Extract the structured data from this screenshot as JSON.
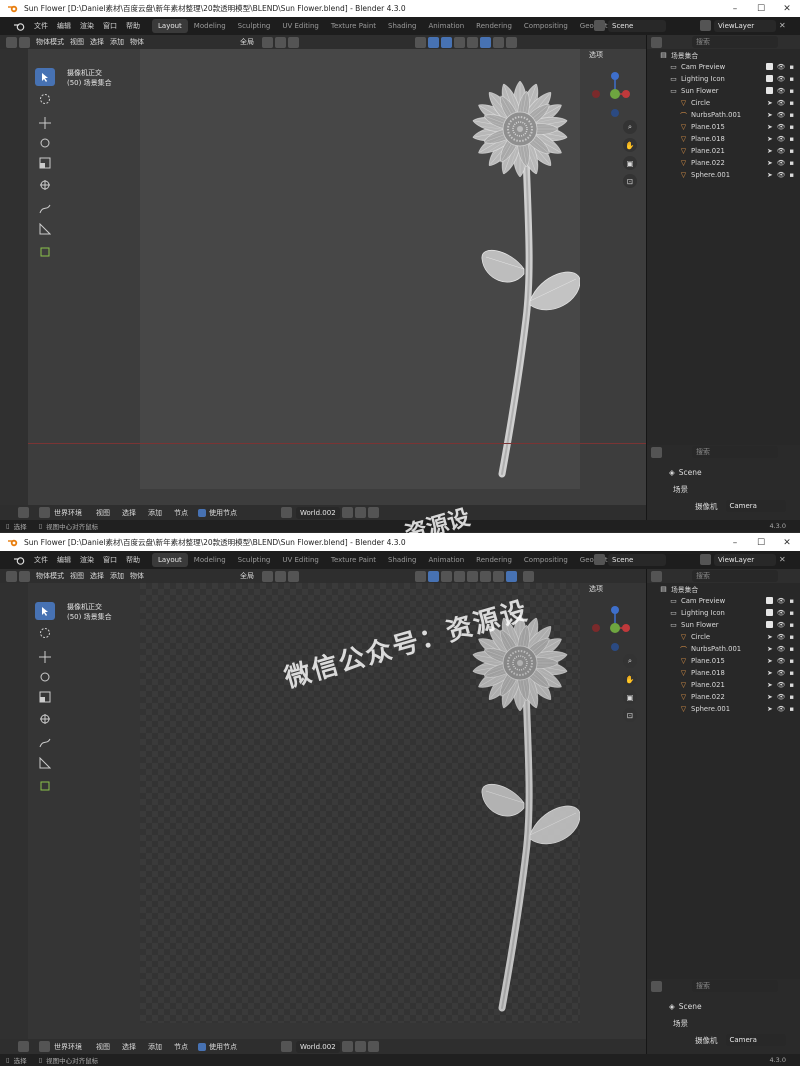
{
  "window": {
    "title": "Sun Flower [D:\\Daniel素材\\百度云盘\\新年素材整理\\20款透明模型\\BLEND\\Sun Flower.blend] - Blender 4.3.0",
    "controls": [
      "–",
      "☐",
      "✕"
    ]
  },
  "menu": [
    "文件",
    "编辑",
    "渲染",
    "窗口",
    "帮助"
  ],
  "workspaces": [
    "Layout",
    "Modeling",
    "Sculpting",
    "UV Editing",
    "Texture Paint",
    "Shading",
    "Animation",
    "Rendering",
    "Compositing",
    "Geometry Nodes"
  ],
  "active_workspace": "Layout",
  "scene": "Scene",
  "view_layer": "ViewLayer",
  "viewport_header": {
    "mode": "物体模式",
    "items": [
      "视图",
      "选择",
      "添加",
      "物体"
    ],
    "transform": "全局",
    "options": "选项"
  },
  "viewport_info": {
    "line1": "摄像机正交",
    "line2": "(50) 场景集合"
  },
  "outliner": {
    "search_placeholder": "搜索",
    "root": "场景集合",
    "rows": [
      {
        "name": "Cam Preview",
        "level": 1,
        "type": "collection"
      },
      {
        "name": "Lighting Icon",
        "level": 1,
        "type": "collection"
      },
      {
        "name": "Sun Flower",
        "level": 1,
        "type": "collection"
      },
      {
        "name": "Circle",
        "level": 2,
        "type": "mesh"
      },
      {
        "name": "NurbsPath.001",
        "level": 2,
        "type": "curve"
      },
      {
        "name": "Plane.015",
        "level": 2,
        "type": "mesh"
      },
      {
        "name": "Plane.018",
        "level": 2,
        "type": "mesh"
      },
      {
        "name": "Plane.021",
        "level": 2,
        "type": "mesh"
      },
      {
        "name": "Plane.022",
        "level": 2,
        "type": "mesh"
      },
      {
        "name": "Sphere.001",
        "level": 2,
        "type": "mesh"
      }
    ]
  },
  "properties": {
    "search_placeholder": "搜索",
    "scene_name": "Scene",
    "panel": "场景",
    "camera_label": "摄像机",
    "camera_value": "Camera"
  },
  "node_bar": {
    "world_env": "世界环境",
    "items": [
      "视图",
      "选择",
      "添加",
      "节点"
    ],
    "use_nodes": "使用节点",
    "world_name": "World.002"
  },
  "status": {
    "select": "选择",
    "center": "视图中心对齐鼠标",
    "version": "4.3.0"
  },
  "watermark": {
    "bottom": "微信公众号：资源设",
    "top": "资源设"
  },
  "colors": {
    "accent": "#4772b3",
    "orange": "#e89a4a",
    "x_axis": "#c0393b",
    "y_axis": "#6ea540",
    "z_axis": "#3e6fcb"
  }
}
